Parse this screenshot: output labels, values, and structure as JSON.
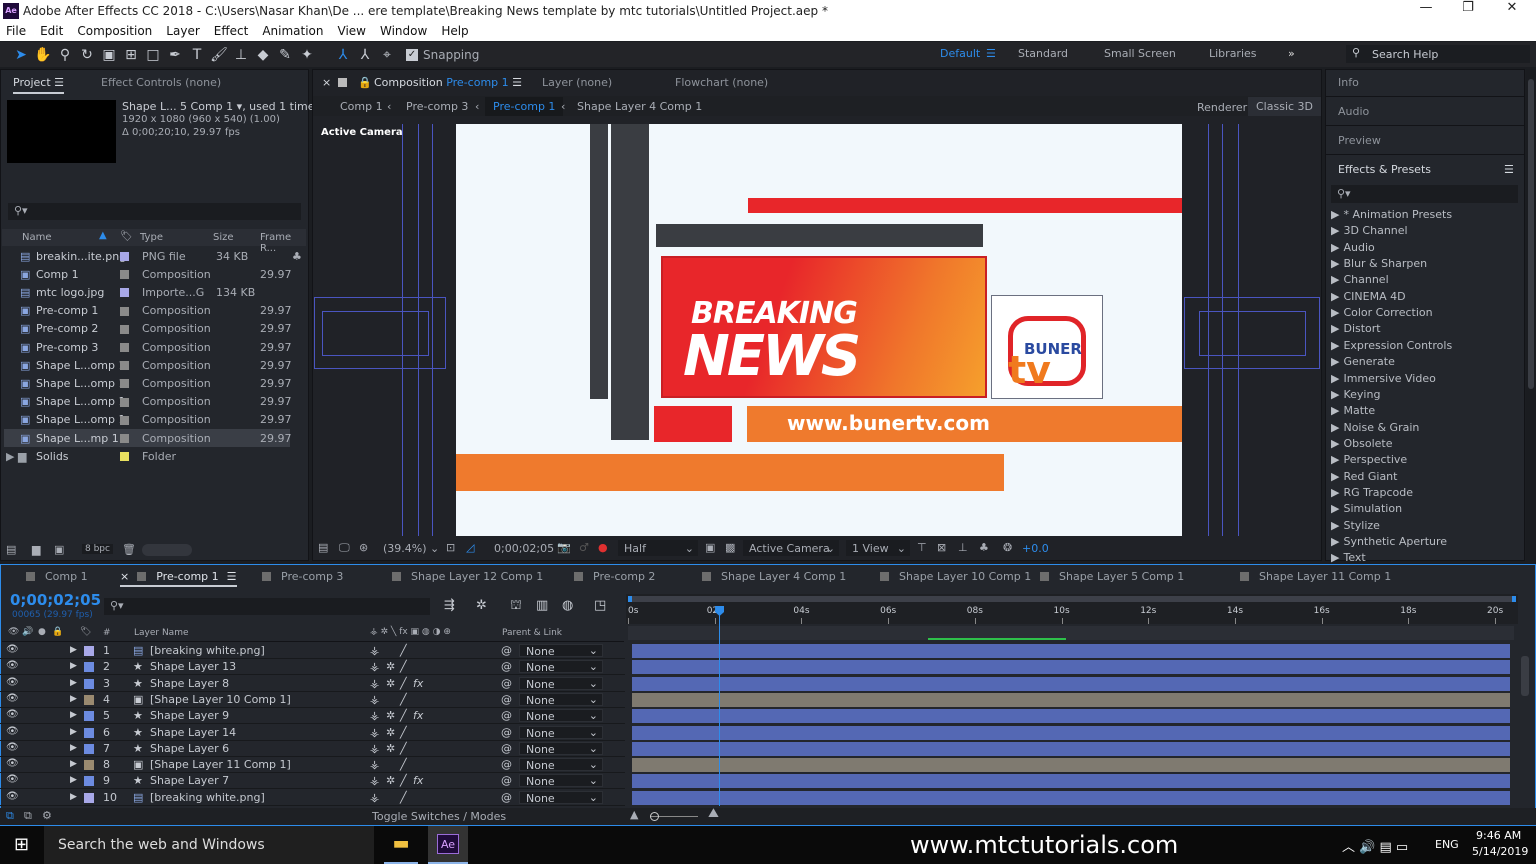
{
  "title": "Adobe After Effects CC 2018 - C:\\Users\\Nasar Khan\\De ... ere template\\Breaking News template by mtc tutorials\\Untitled Project.aep *",
  "app_badge": "Ae",
  "menu": [
    "File",
    "Edit",
    "Composition",
    "Layer",
    "Effect",
    "Animation",
    "View",
    "Window",
    "Help"
  ],
  "toolbar": {
    "snapping": "Snapping",
    "workspaces": [
      "Default",
      "Standard",
      "Small Screen",
      "Libraries"
    ],
    "active_workspace": "Default",
    "search_help": "Search Help"
  },
  "project": {
    "tab": "Project",
    "tab2": "Effect Controls (none)",
    "selected_name": "Shape L... 5 Comp 1",
    "used": ", used 1 time",
    "dims": "1920 x 1080  (960 x 540) (1.00)",
    "duration": "Δ 0;00;20;10, 29.97 fps",
    "columns": [
      "Name",
      "Type",
      "Size",
      "Frame R..."
    ],
    "bpc": "8 bpc",
    "items": [
      {
        "name": "breakin...ite.png",
        "type": "PNG file",
        "size": "34 KB",
        "fps": "",
        "icon": "png",
        "color": "#a8a8e8"
      },
      {
        "name": "Comp 1",
        "type": "Composition",
        "size": "",
        "fps": "29.97",
        "icon": "comp",
        "color": "#8a8a8a"
      },
      {
        "name": "mtc logo.jpg",
        "type": "Importe...G",
        "size": "134 KB",
        "fps": "",
        "icon": "png",
        "color": "#a8a8e8"
      },
      {
        "name": "Pre-comp 1",
        "type": "Composition",
        "size": "",
        "fps": "29.97",
        "icon": "comp",
        "color": "#8a8a8a"
      },
      {
        "name": "Pre-comp 2",
        "type": "Composition",
        "size": "",
        "fps": "29.97",
        "icon": "comp",
        "color": "#8a8a8a"
      },
      {
        "name": "Pre-comp 3",
        "type": "Composition",
        "size": "",
        "fps": "29.97",
        "icon": "comp",
        "color": "#8a8a8a"
      },
      {
        "name": "Shape L...omp 1",
        "type": "Composition",
        "size": "",
        "fps": "29.97",
        "icon": "comp",
        "color": "#8a8a8a"
      },
      {
        "name": "Shape L...omp 1",
        "type": "Composition",
        "size": "",
        "fps": "29.97",
        "icon": "comp",
        "color": "#8a8a8a"
      },
      {
        "name": "Shape L...omp 1",
        "type": "Composition",
        "size": "",
        "fps": "29.97",
        "icon": "comp",
        "color": "#8a8a8a"
      },
      {
        "name": "Shape L...omp 1",
        "type": "Composition",
        "size": "",
        "fps": "29.97",
        "icon": "comp",
        "color": "#8a8a8a"
      },
      {
        "name": "Shape L...mp 1",
        "type": "Composition",
        "size": "",
        "fps": "29.97",
        "icon": "comp",
        "color": "#8a8a8a"
      },
      {
        "name": "Solids",
        "type": "Folder",
        "size": "",
        "fps": "",
        "icon": "folder",
        "color": "#e8e060"
      }
    ]
  },
  "viewer": {
    "tab": "Composition",
    "tab_comp": "Pre-comp 1",
    "tab_layer": "Layer (none)",
    "tab_flow": "Flowchart (none)",
    "breadcrumb": [
      "Comp 1",
      "Pre-comp 3",
      "Pre-comp 1",
      "Shape Layer 4 Comp 1"
    ],
    "active_breadcrumb": "Pre-comp 1",
    "renderer_label": "Renderer:",
    "renderer": "Classic 3D",
    "camera_label": "Active Camera",
    "canvas": {
      "headline1": "BREAKING",
      "headline2": "NEWS",
      "url": "www.bunertv.com",
      "logo1": "BUNER",
      "logo2": "tv"
    },
    "bottom": {
      "zoom": "(39.4%)",
      "time": "0;00;02;05",
      "resolution": "Half",
      "camera": "Active Camera",
      "views": "1 View",
      "exposure": "+0.0"
    }
  },
  "right": {
    "panels": [
      "Info",
      "Audio",
      "Preview"
    ],
    "effects_title": "Effects & Presets",
    "effects": [
      "* Animation Presets",
      "3D Channel",
      "Audio",
      "Blur & Sharpen",
      "Channel",
      "CINEMA 4D",
      "Color Correction",
      "Distort",
      "Expression Controls",
      "Generate",
      "Immersive Video",
      "Keying",
      "Matte",
      "Noise & Grain",
      "Obsolete",
      "Perspective",
      "Red Giant",
      "RG Trapcode",
      "Simulation",
      "Stylize",
      "Synthetic Aperture",
      "Text"
    ]
  },
  "timeline": {
    "tabs": [
      "Comp 1",
      "Pre-comp 1",
      "Pre-comp 3",
      "Shape Layer 12 Comp 1",
      "Pre-comp 2",
      "Shape Layer 4 Comp 1",
      "Shape Layer 10 Comp 1",
      "Shape Layer 5 Comp 1",
      "Shape Layer 11 Comp 1"
    ],
    "active_tab": "Pre-comp 1",
    "timecode": "0;00;02;05",
    "frames": "00065 (29.97 fps)",
    "col_layer": "Layer Name",
    "col_parent": "Parent & Link",
    "col_num": "#",
    "toggle": "Toggle Switches / Modes",
    "current_time_s": 2.17,
    "ruler": [
      "0s",
      "02s",
      "04s",
      "06s",
      "08s",
      "10s",
      "12s",
      "14s",
      "16s",
      "18s",
      "20s"
    ],
    "layers": [
      {
        "n": "1",
        "name": "[breaking white.png]",
        "type": "footage",
        "fx": false,
        "parent": "None",
        "color": "#a8a8e8",
        "bar": "#5468b4"
      },
      {
        "n": "2",
        "name": "Shape Layer 13",
        "type": "shape",
        "fx": false,
        "parent": "None",
        "color": "#6c8be0",
        "bar": "#5468b4"
      },
      {
        "n": "3",
        "name": "Shape Layer 8",
        "type": "shape",
        "fx": true,
        "parent": "None",
        "color": "#6c8be0",
        "bar": "#5468b4"
      },
      {
        "n": "4",
        "name": "[Shape Layer 10 Comp 1]",
        "type": "comp",
        "fx": false,
        "parent": "None",
        "color": "#9a8a70",
        "bar": "#7f7a70"
      },
      {
        "n": "5",
        "name": "Shape Layer 9",
        "type": "shape",
        "fx": true,
        "parent": "None",
        "color": "#6c8be0",
        "bar": "#5468b4"
      },
      {
        "n": "6",
        "name": "Shape Layer 14",
        "type": "shape",
        "fx": false,
        "parent": "None",
        "color": "#6c8be0",
        "bar": "#5468b4"
      },
      {
        "n": "7",
        "name": "Shape Layer 6",
        "type": "shape",
        "fx": false,
        "parent": "None",
        "color": "#6c8be0",
        "bar": "#5468b4"
      },
      {
        "n": "8",
        "name": "[Shape Layer 11 Comp 1]",
        "type": "comp",
        "fx": false,
        "parent": "None",
        "color": "#9a8a70",
        "bar": "#7f7a70"
      },
      {
        "n": "9",
        "name": "Shape Layer 7",
        "type": "shape",
        "fx": true,
        "parent": "None",
        "color": "#6c8be0",
        "bar": "#5468b4"
      },
      {
        "n": "10",
        "name": "[breaking white.png]",
        "type": "footage",
        "fx": false,
        "parent": "None",
        "color": "#a8a8e8",
        "bar": "#5468b4"
      }
    ]
  },
  "taskbar": {
    "search": "Search the web and Windows",
    "watermark": "www.mtctutorials.com",
    "lang": "ENG",
    "time": "9:46 AM",
    "date": "5/14/2019"
  },
  "colors": {
    "accent": "#2d8ceb",
    "breaking_red": "#e8262a",
    "orange": "#ef7a2d"
  }
}
